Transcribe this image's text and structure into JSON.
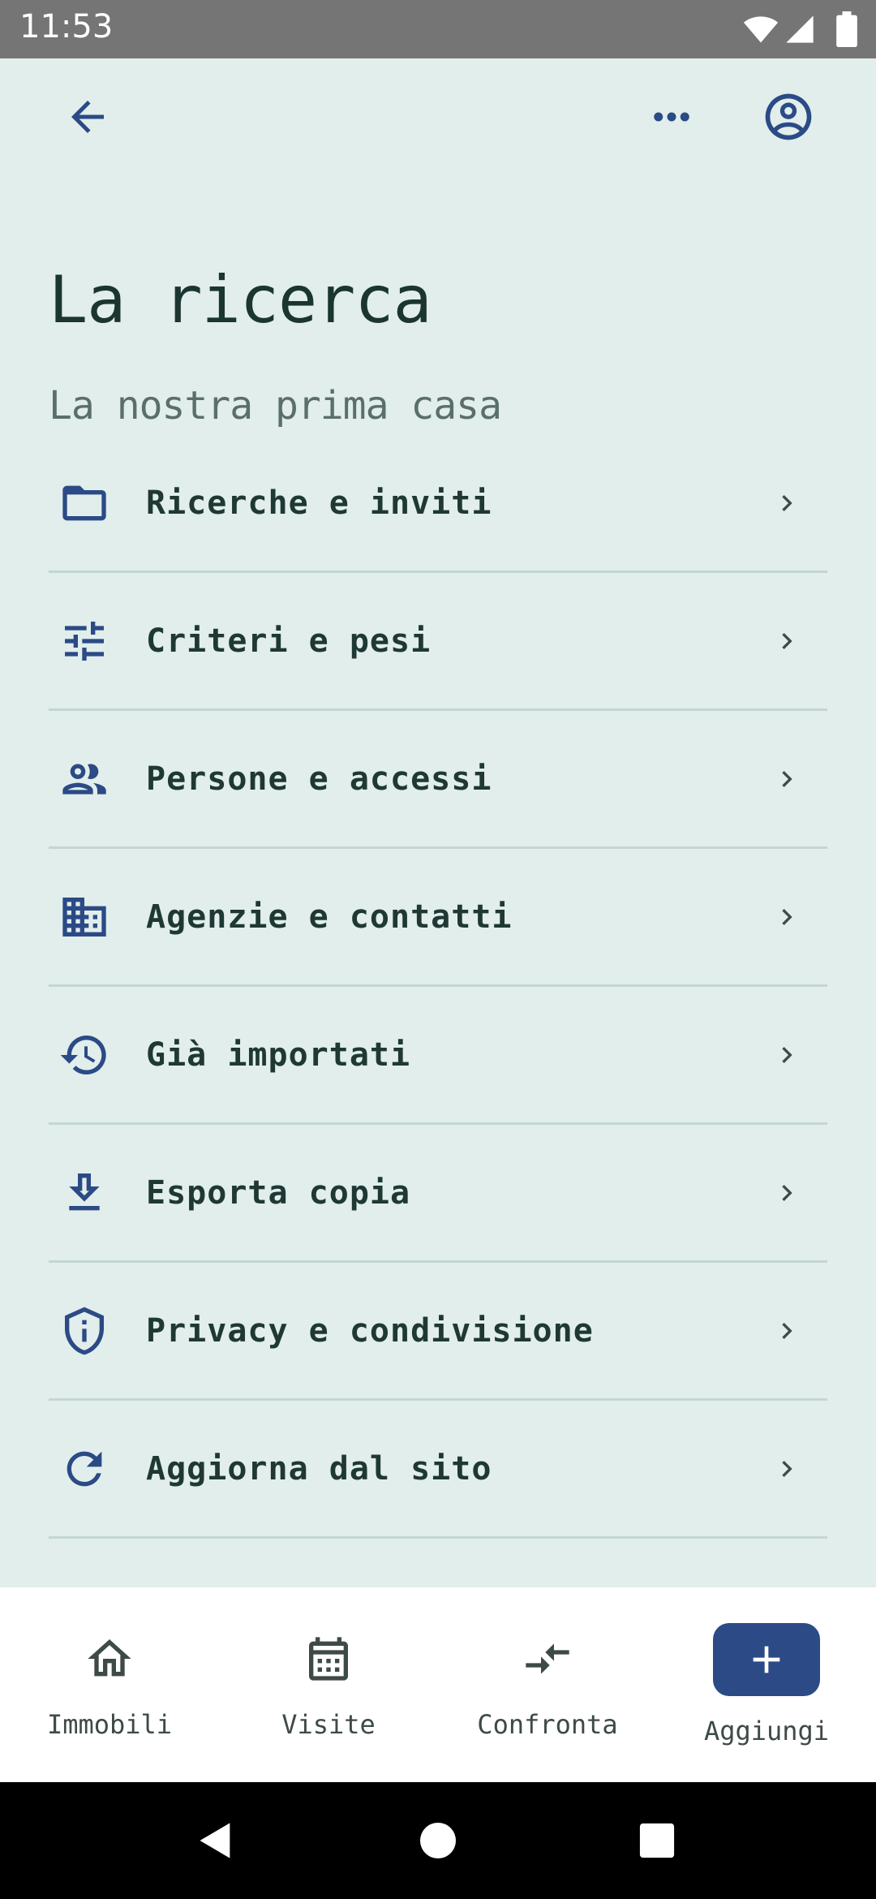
{
  "status_bar": {
    "time": "11:53",
    "icons": [
      "wifi-icon",
      "signal-icon",
      "battery-icon"
    ]
  },
  "app_bar": {
    "back_icon": "arrow-back-icon",
    "more_icon": "more-horiz-icon",
    "profile_icon": "account-circle-icon"
  },
  "header": {
    "title": "La ricerca",
    "subtitle": "La nostra prima casa"
  },
  "menu": {
    "items": [
      {
        "label": "Ricerche e inviti",
        "icon": "folder-icon"
      },
      {
        "label": "Criteri e pesi",
        "icon": "tune-icon"
      },
      {
        "label": "Persone e accessi",
        "icon": "people-icon"
      },
      {
        "label": "Agenzie e contatti",
        "icon": "business-icon"
      },
      {
        "label": "Già importati",
        "icon": "history-icon"
      },
      {
        "label": "Esporta copia",
        "icon": "download-icon"
      },
      {
        "label": "Privacy e condivisione",
        "icon": "shield-icon"
      },
      {
        "label": "Aggiorna dal sito",
        "icon": "refresh-icon"
      }
    ]
  },
  "bottom_nav": {
    "items": [
      {
        "label": "Immobili",
        "icon": "home-icon"
      },
      {
        "label": "Visite",
        "icon": "calendar-icon"
      },
      {
        "label": "Confronta",
        "icon": "compare-arrows-icon"
      },
      {
        "label": "Aggiungi",
        "icon": "add-icon"
      }
    ]
  },
  "colors": {
    "background": "#e1eeeb",
    "accent": "#2b4a86",
    "text_primary": "#1f3833",
    "divider": "#c3d6d2"
  }
}
